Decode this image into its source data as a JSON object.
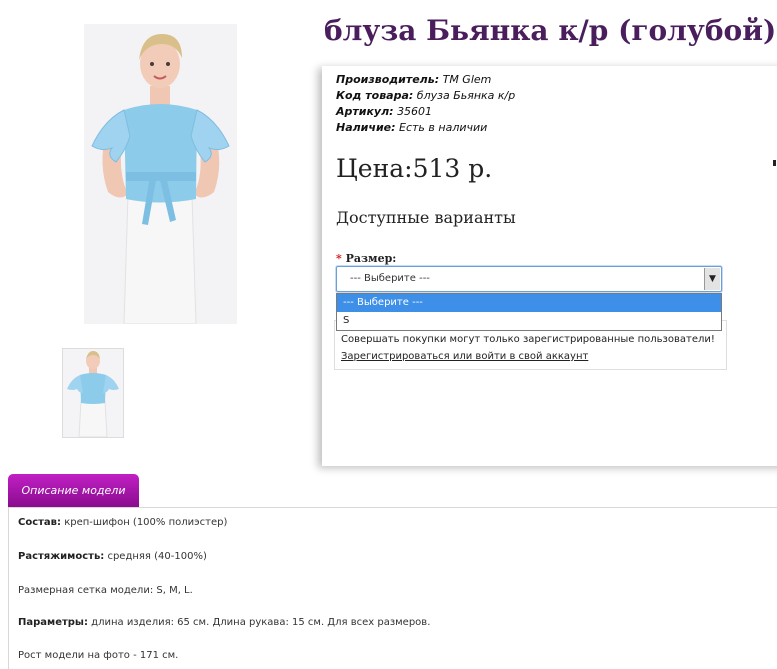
{
  "product": {
    "title": "блуза Бьянка к/р (голубой)",
    "meta": [
      {
        "key": "Производитель:",
        "value": "TM Glem"
      },
      {
        "key": "Код товара:",
        "value": "блуза Бьянка к/р"
      },
      {
        "key": "Артикул:",
        "value": "35601"
      },
      {
        "key": "Наличие:",
        "value": "Есть в наличии"
      }
    ],
    "price": "Цена:513 р."
  },
  "variants": {
    "title": "Доступные варианты",
    "size_required_mark": "*",
    "size_label": "Размер:",
    "selected_value": "--- Выберите ---",
    "options": [
      "--- Выберите ---",
      "S"
    ]
  },
  "notice": {
    "text": "Совершать покупки могут только зарегистрированные пользователи!",
    "link": "Зарегистрироваться или войти в свой аккаунт"
  },
  "tabs": {
    "description_label": "Описание модели"
  },
  "description": [
    {
      "label": "Состав:",
      "text": " креп-шифон (100% полиэстер)"
    },
    {
      "label": "Растяжимость:",
      "text": " средняя (40-100%)"
    },
    {
      "label": "",
      "text": "Размерная сетка модели: S, M, L."
    },
    {
      "label": "Параметры:",
      "text": " длина изделия: 65 см. Длина рукава: 15 см. Для всех размеров."
    },
    {
      "label": "",
      "text": "Рост модели на фото - 171 см."
    }
  ],
  "colors": {
    "title": "#4a1e5c",
    "tab": "#a416a8",
    "select_highlight": "#3d8fe8",
    "blouse": "#8ccbea",
    "skirt": "#f4f4f4"
  }
}
